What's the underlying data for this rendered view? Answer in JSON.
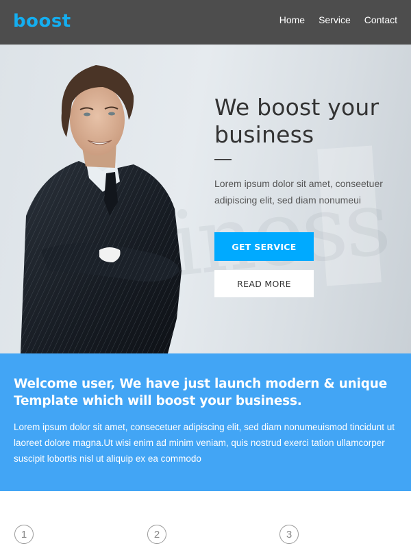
{
  "header": {
    "logo": "boost",
    "nav": [
      {
        "label": "Home"
      },
      {
        "label": "Service"
      },
      {
        "label": "Contact"
      }
    ]
  },
  "hero": {
    "title": "We boost your business",
    "text": "Lorem ipsum dolor sit amet, conseetuer adipiscing elit, sed diam nonumeui",
    "primary_button": "GET SERVICE",
    "secondary_button": "READ MORE",
    "background_word": "iness",
    "photo_alt": "smiling businessman in pinstripe suit with arms crossed"
  },
  "welcome": {
    "title": "Welcome user, We have just launch modern & unique Template which will boost your business.",
    "text": "Lorem ipsum dolor sit amet, consecetuer adipiscing elit, sed diam nonumeuismod tincidunt ut laoreet dolore magna.Ut wisi enim ad minim veniam, quis nostrud exerci tation ullamcorper suscipit lobortis nisl ut aliquip ex ea commodo"
  },
  "steps": [
    {
      "number": "1"
    },
    {
      "number": "2"
    },
    {
      "number": "3"
    }
  ],
  "colors": {
    "header_bg": "#4d4d4d",
    "logo": "#14aef0",
    "primary_button": "#00aaff",
    "welcome_bg": "#42a5f5"
  }
}
